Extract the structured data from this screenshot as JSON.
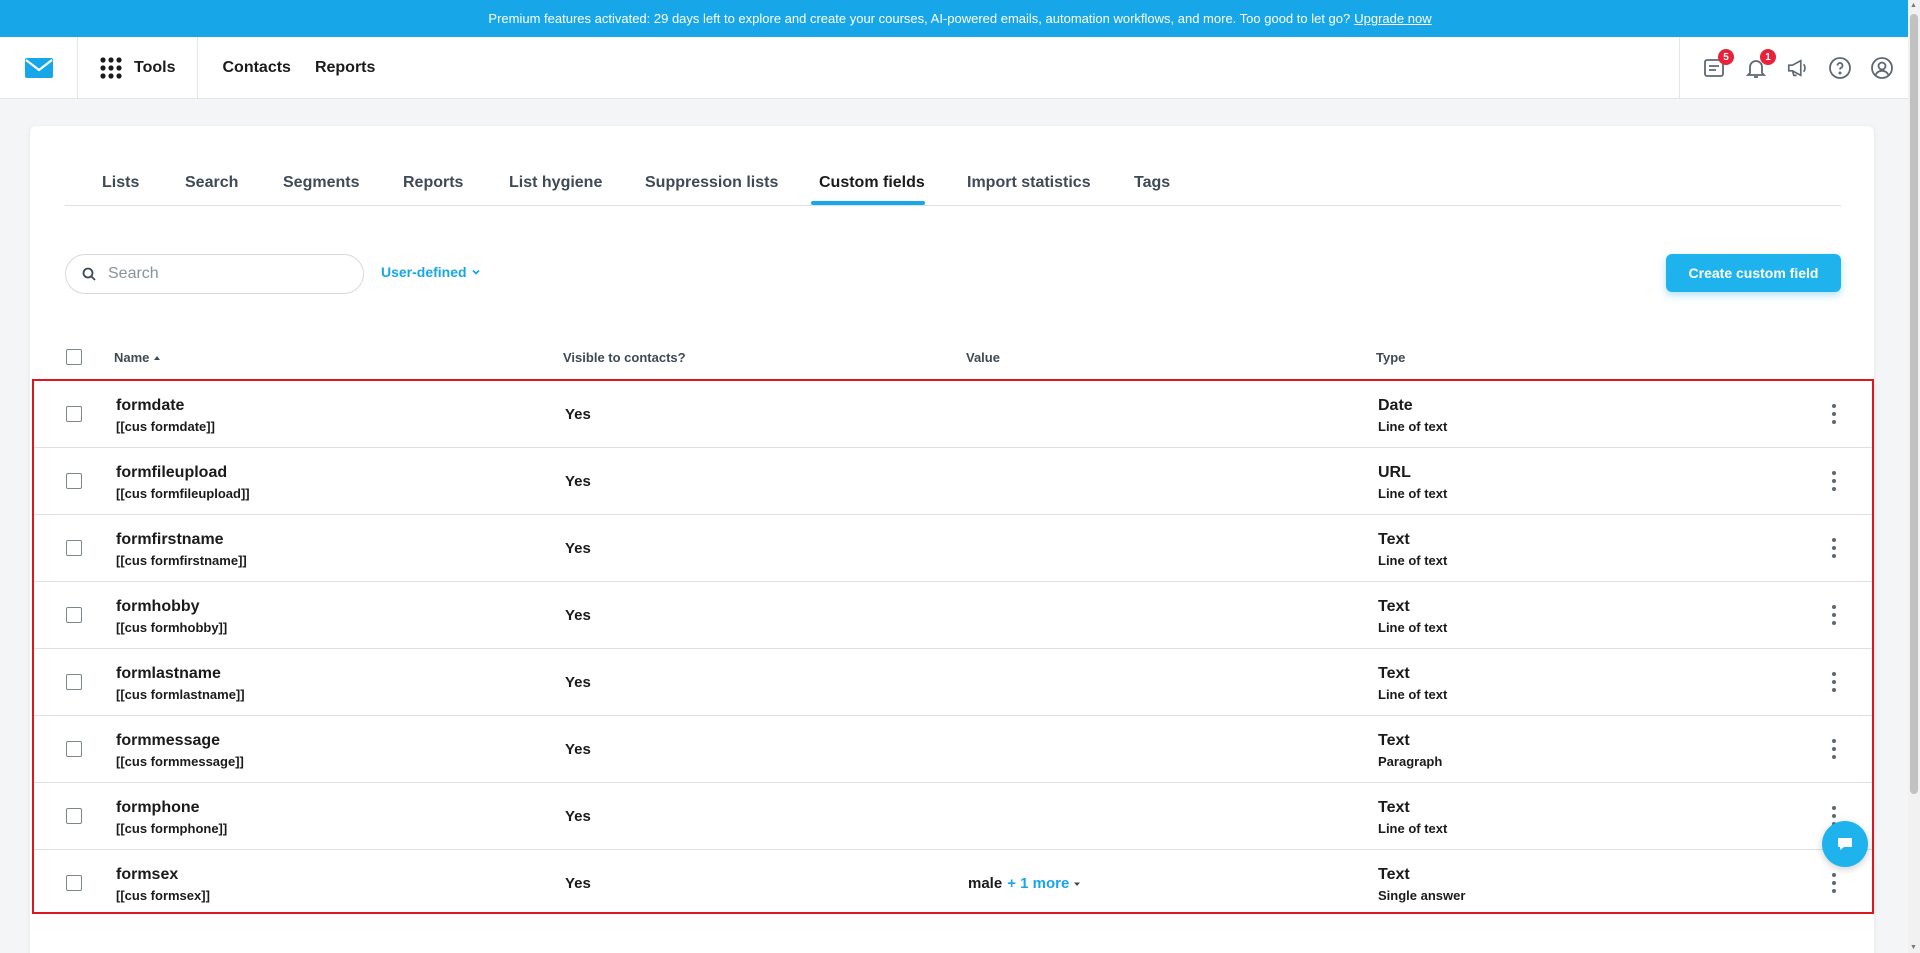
{
  "banner": {
    "text": "Premium features activated: 29 days left to explore and create your courses, AI-powered emails, automation workflows, and more. Too good to let go?",
    "link": "Upgrade now"
  },
  "topnav": {
    "tools": "Tools",
    "contacts": "Contacts",
    "reports": "Reports",
    "badges": {
      "courses": "5",
      "notifications": "1"
    }
  },
  "tabs": [
    {
      "label": "Lists"
    },
    {
      "label": "Search"
    },
    {
      "label": "Segments"
    },
    {
      "label": "Reports"
    },
    {
      "label": "List hygiene"
    },
    {
      "label": "Suppression lists"
    },
    {
      "label": "Custom fields"
    },
    {
      "label": "Import statistics"
    },
    {
      "label": "Tags"
    }
  ],
  "active_tab": "Custom fields",
  "toolbar": {
    "search_placeholder": "Search",
    "filter": "User-defined",
    "create_label": "Create custom field"
  },
  "table": {
    "headers": {
      "name": "Name",
      "visible": "Visible to contacts?",
      "value": "Value",
      "type": "Type"
    },
    "rows": [
      {
        "name": "formdate",
        "tag": "[[cus formdate]]",
        "visible": "Yes",
        "value": "",
        "more": "",
        "type": "Date",
        "subtype": "Line of text"
      },
      {
        "name": "formfileupload",
        "tag": "[[cus formfileupload]]",
        "visible": "Yes",
        "value": "",
        "more": "",
        "type": "URL",
        "subtype": "Line of text"
      },
      {
        "name": "formfirstname",
        "tag": "[[cus formfirstname]]",
        "visible": "Yes",
        "value": "",
        "more": "",
        "type": "Text",
        "subtype": "Line of text"
      },
      {
        "name": "formhobby",
        "tag": "[[cus formhobby]]",
        "visible": "Yes",
        "value": "",
        "more": "",
        "type": "Text",
        "subtype": "Line of text"
      },
      {
        "name": "formlastname",
        "tag": "[[cus formlastname]]",
        "visible": "Yes",
        "value": "",
        "more": "",
        "type": "Text",
        "subtype": "Line of text"
      },
      {
        "name": "formmessage",
        "tag": "[[cus formmessage]]",
        "visible": "Yes",
        "value": "",
        "more": "",
        "type": "Text",
        "subtype": "Paragraph"
      },
      {
        "name": "formphone",
        "tag": "[[cus formphone]]",
        "visible": "Yes",
        "value": "",
        "more": "",
        "type": "Text",
        "subtype": "Line of text"
      },
      {
        "name": "formsex",
        "tag": "[[cus formsex]]",
        "visible": "Yes",
        "value": "male",
        "more": "+ 1 more",
        "type": "Text",
        "subtype": "Single answer"
      }
    ]
  },
  "colors": {
    "accent": "#17a7e8",
    "highlight_border": "#e0161d",
    "badge": "#e8223a"
  }
}
